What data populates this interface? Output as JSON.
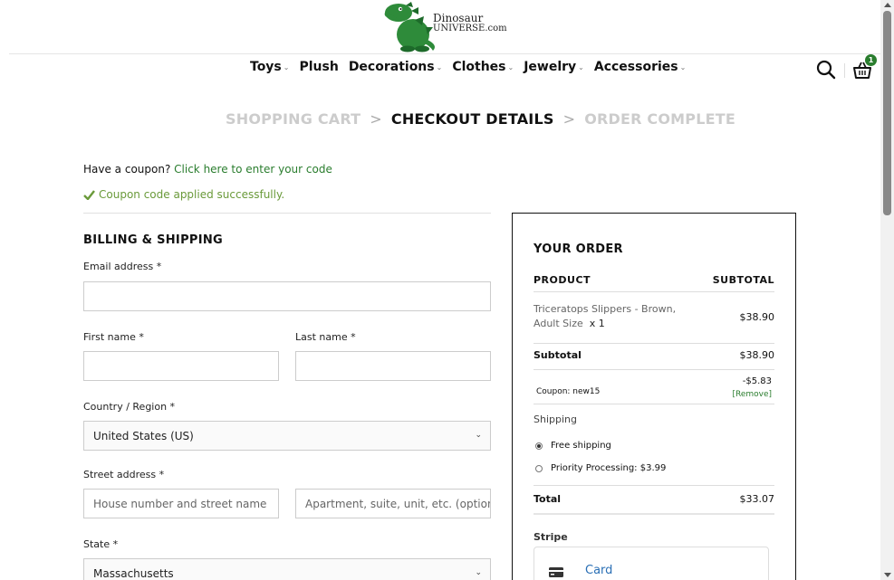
{
  "header": {
    "logo_line1": "Dinosaur",
    "logo_line2": "UNIVERSE.com",
    "nav": [
      {
        "label": "Toys",
        "has_dropdown": true
      },
      {
        "label": "Plush",
        "has_dropdown": false
      },
      {
        "label": "Decorations",
        "has_dropdown": true
      },
      {
        "label": "Clothes",
        "has_dropdown": true
      },
      {
        "label": "Jewelry",
        "has_dropdown": true
      },
      {
        "label": "Accessories",
        "has_dropdown": true
      }
    ],
    "cart_count": "1",
    "icons": {
      "search": "search-icon",
      "cart": "cart-basket-icon"
    }
  },
  "steps": {
    "step1": "SHOPPING CART",
    "step2": "CHECKOUT DETAILS",
    "step3": "ORDER COMPLETE",
    "separator": ">"
  },
  "coupon": {
    "question": "Have a coupon?",
    "link": "Click here to enter your code",
    "success": "Coupon code applied successfully."
  },
  "billing": {
    "title": "BILLING & SHIPPING",
    "email_label": "Email address *",
    "first_label": "First name *",
    "last_label": "Last name *",
    "country_label": "Country / Region *",
    "country_value": "United States (US)",
    "street_label": "Street address *",
    "street_placeholder": "House number and street name",
    "street2_placeholder": "Apartment, suite, unit, etc. (optional)",
    "state_label": "State *",
    "state_value": "Massachusetts"
  },
  "order": {
    "title": "YOUR ORDER",
    "col_product": "PRODUCT",
    "col_subtotal": "SUBTOTAL",
    "product_name": "Triceratops Slippers - Brown, Adult Size",
    "product_qty": "x 1",
    "product_price": "$38.90",
    "subtotal_label": "Subtotal",
    "subtotal_value": "$38.90",
    "coupon_label": "Coupon: new15",
    "coupon_value": "-$5.83",
    "coupon_remove": "[Remove]",
    "shipping_label": "Shipping",
    "ship_free": "Free shipping",
    "ship_priority": "Priority Processing:",
    "ship_priority_price": "$3.99",
    "total_label": "Total",
    "total_value": "$33.07",
    "payment_label": "Stripe",
    "card_label": "Card"
  },
  "colors": {
    "accent_green": "#2a7d2e",
    "success_green": "#6a9a3a",
    "link_blue": "#2a6fb5"
  }
}
